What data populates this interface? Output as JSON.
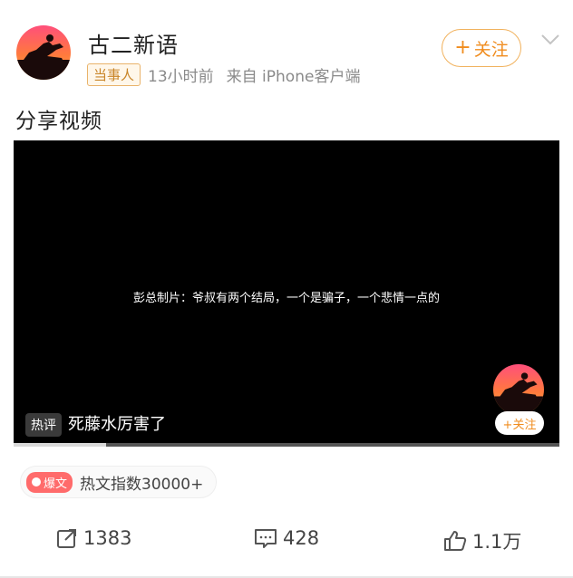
{
  "user": {
    "name": "古二新语",
    "badge": "当事人",
    "time": "13小时前",
    "source": "来自 iPhone客户端",
    "follow_label": "关注",
    "follow_plus": "+"
  },
  "post": {
    "text": "分享视频"
  },
  "video": {
    "subtitle": "彭总制片：爷叔有两个结局，一个是骗子，一个悲情一点的",
    "hot_tag": "热评",
    "hot_comment": "死藤水厉害了",
    "follow_label": "+关注",
    "progress_fraction": 0.17
  },
  "hot_index": {
    "badge": "爆文",
    "label": "热文指数30000+"
  },
  "actions": {
    "repost_count": "1383",
    "comment_count": "428",
    "like_count": "1.1万"
  },
  "colors": {
    "accent": "#f08c1e",
    "badge_border": "#e9b36a",
    "hot_badge": "#ff6b6b"
  }
}
